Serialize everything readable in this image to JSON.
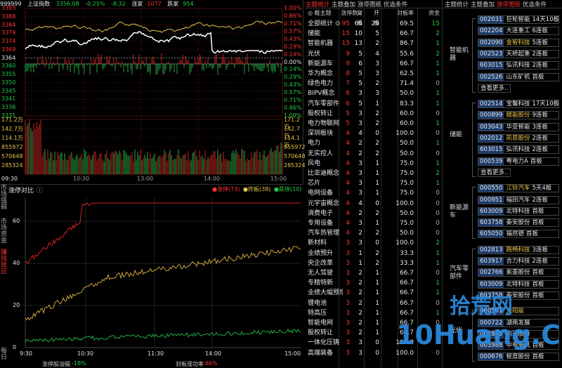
{
  "index_chart": {
    "code": "999999",
    "name": "上证指数",
    "price": "3356.08",
    "pct": "-0.25%",
    "chg": "-8.32",
    "up_label": "涨家",
    "up": "1077",
    "down_label": "跌家",
    "down": "954",
    "y_left": [
      "3393",
      "3388",
      "3384",
      "3379",
      "3374",
      "3369",
      "3364",
      "3360",
      "3355",
      "3350",
      "3345",
      "3341",
      "3336",
      "3331"
    ],
    "y_right": [
      "1.00%",
      "0.86%",
      "0.71%",
      "0.57%",
      "0.43%",
      "0.29%",
      "0.14%",
      "0.00%",
      "0.14%",
      "0.29%",
      "0.43%",
      "0.57%",
      "0.71%",
      "0.86%",
      "1.00%"
    ],
    "vol_left": [
      "171.2万",
      "142.7万",
      "114.1万",
      "855972",
      "570648",
      "285324"
    ],
    "vol_right": [
      "171.2万",
      "142.7万",
      "114.1万",
      "855972",
      "570648",
      "285324"
    ],
    "times": [
      "09:30",
      "10:30",
      "13:00",
      "14:00",
      "15:00"
    ]
  },
  "limit_chart": {
    "title": "涨停对比",
    "legend": [
      {
        "label": "●涨停(73)",
        "color": "#ff3333"
      },
      {
        "label": "●炸板(38)",
        "color": "#e5c34b"
      },
      {
        "label": "●跌停(10)",
        "color": "#22cc44"
      }
    ],
    "side": [
      {
        "label": "市场强弱",
        "active": false
      },
      {
        "label": "市场资金",
        "active": false
      },
      {
        "label": "赚钱效应",
        "active": true
      },
      {
        "label": "每日",
        "active": false
      }
    ],
    "times": [
      "9:30",
      "10:30",
      "11:30",
      "14:00",
      "15:00"
    ],
    "y": [
      "60",
      "40",
      "20",
      "0"
    ],
    "foot_left_label": "涨停股溢幅",
    "foot_left_val": "-18%",
    "foot_right_label": "封板成功率",
    "foot_right_val": "66%"
  },
  "stats": {
    "tabs": [
      {
        "label": "主题统计",
        "on": true
      },
      {
        "label": "主题叠加",
        "on": false
      },
      {
        "label": "涨停图纸",
        "on": false
      },
      {
        "label": "优选条件",
        "on": false
      }
    ],
    "headers": [
      "◎ 概主题",
      "涨停数↓",
      "封板",
      "开板",
      "封板率",
      "资金"
    ],
    "rows": [
      [
        "全部统计 ⊙",
        "95",
        "66",
        "29",
        "69.5",
        "15"
      ],
      [
        "储能",
        "15",
        "10",
        "5",
        "66.7",
        "2"
      ],
      [
        "智能机器",
        "15",
        "13",
        "2",
        "86.7",
        "1"
      ],
      [
        "光伏",
        "9",
        "5",
        "4",
        "55.6",
        "2"
      ],
      [
        "新能源车",
        "9",
        "6",
        "3",
        "66.7",
        "1"
      ],
      [
        "华为概念",
        "8",
        "5",
        "3",
        "62.5",
        "1"
      ],
      [
        "绿色电力",
        "7",
        "5",
        "2",
        "71.4",
        "0"
      ],
      [
        "BIPV概念",
        "6",
        "3",
        "3",
        "50.0",
        "1"
      ],
      [
        "汽车零部件",
        "6",
        "5",
        "1",
        "83.3",
        "1"
      ],
      [
        "股权转让",
        "5",
        "3",
        "2",
        "60.0",
        "0"
      ],
      [
        "电力物联网",
        "5",
        "3",
        "2",
        "60.0",
        "1"
      ],
      [
        "深圳板块",
        "4",
        "4",
        "0",
        "100.0",
        "0"
      ],
      [
        "电力",
        "4",
        "2",
        "2",
        "50.0",
        "1"
      ],
      [
        "无实控人",
        "4",
        "2",
        "2",
        "50.0",
        "0"
      ],
      [
        "风电",
        "4",
        "3",
        "1",
        "75.0",
        "1"
      ],
      [
        "比亚迪概念",
        "4",
        "3",
        "1",
        "75.0",
        "2"
      ],
      [
        "芯片",
        "4",
        "3",
        "1",
        "75.0",
        "1"
      ],
      [
        "电网设备",
        "4",
        "3",
        "1",
        "75.0",
        "0"
      ],
      [
        "元宇宙概念",
        "4",
        "4",
        "0",
        "100.0",
        "0"
      ],
      [
        "消费电子",
        "4",
        "2",
        "2",
        "50.0",
        "0"
      ],
      [
        "专用设备",
        "4",
        "3",
        "1",
        "75.0",
        "0"
      ],
      [
        "汽车热管理",
        "4",
        "2",
        "2",
        "50.0",
        "0"
      ],
      [
        "新材料",
        "3",
        "3",
        "0",
        "100.0",
        "2"
      ],
      [
        "业绩预升",
        "3",
        "1",
        "2",
        "33.3",
        "1"
      ],
      [
        "央企改革",
        "3",
        "1",
        "2",
        "33.3",
        "1"
      ],
      [
        "无人驾驶",
        "3",
        "2",
        "1",
        "66.7",
        "0"
      ],
      [
        "专精特新",
        "3",
        "2",
        "1",
        "66.7",
        "1"
      ],
      [
        "业绩大幅预增",
        "3",
        "2",
        "1",
        "66.7",
        "1"
      ],
      [
        "锂电池",
        "3",
        "2",
        "1",
        "66.7",
        "0"
      ],
      [
        "特高压",
        "3",
        "2",
        "1",
        "66.7",
        "1"
      ],
      [
        "智能电网",
        "3",
        "2",
        "1",
        "66.7",
        "0"
      ],
      [
        "股权转让",
        "3",
        "2",
        "1",
        "66.7",
        "0"
      ],
      [
        "一体化压铸",
        "3",
        "3",
        "0",
        "100.0",
        "0"
      ],
      [
        "高端装备",
        "3",
        "3",
        "0",
        "100.0",
        "0"
      ]
    ]
  },
  "stocks": {
    "tabs": [
      {
        "label": "主题统计",
        "on": false
      },
      {
        "label": "主题叠加",
        "on": false
      },
      {
        "label": "涨停图纸",
        "on": true
      },
      {
        "label": "优选条件",
        "on": false
      }
    ],
    "groups": [
      {
        "name": "智能机器",
        "items": [
          [
            "002031",
            "巨轮智能",
            "14天10板",
            false
          ],
          [
            "002204",
            "大连重工",
            "6连板",
            false
          ],
          [
            "002090",
            "金智科技",
            "5连板",
            true
          ],
          [
            "002523",
            "天桥起重",
            "2连板",
            false
          ],
          [
            "603015",
            "弘讯科技",
            "2连板",
            false
          ],
          [
            "002526",
            "山东矿机",
            "首板",
            false
          ]
        ]
      },
      {
        "name": "储能",
        "items": [
          [
            "002514",
            "宝馨科技",
            "17天10板",
            false
          ],
          [
            "000899",
            "赣能股份",
            "9连板",
            true
          ],
          [
            "003043",
            "华亚智能",
            "3连板",
            false
          ],
          [
            "002012",
            "凯恩股份",
            "2连板",
            true
          ],
          [
            "603015",
            "弘讯科技",
            "2连板",
            false
          ],
          [
            "000539",
            "粤电力A",
            "首板",
            false
          ]
        ]
      },
      {
        "name": "新能源车",
        "items": [
          [
            "000550",
            "江铃汽车",
            "5天4板",
            true
          ],
          [
            "000951",
            "福田汽车",
            "2连板",
            false
          ],
          [
            "603009",
            "北特科技",
            "首板",
            false
          ],
          [
            "603758",
            "秦安股份",
            "首板",
            false
          ],
          [
            "605050",
            "福然德",
            "首板",
            false
          ]
        ]
      },
      {
        "name": "汽车零部件",
        "items": [
          [
            "002813",
            "路畅科技",
            "3连板",
            true
          ],
          [
            "603917",
            "合力科技",
            "2连板",
            false
          ],
          [
            "002766",
            "索菱股份",
            "首板",
            false
          ],
          [
            "603009",
            "北特科技",
            "首板",
            false
          ],
          [
            "603758",
            "秦安股份",
            "首板",
            false
          ]
        ]
      },
      {
        "name": "光伏",
        "items": [
          [
            "000591",
            "太阳能",
            "",
            true
          ],
          [
            "000722",
            "湖南发展",
            "",
            false
          ],
          [
            "002865",
            "钧达股份",
            "",
            false
          ],
          [
            "603988",
            "中电电机",
            "首板",
            false
          ],
          [
            "000676",
            "智度股份",
            "首板",
            false
          ]
        ]
      }
    ],
    "more": "查看更多.."
  },
  "watermark": {
    "cn": "拾荒网",
    "en": "10Huang.CN"
  }
}
